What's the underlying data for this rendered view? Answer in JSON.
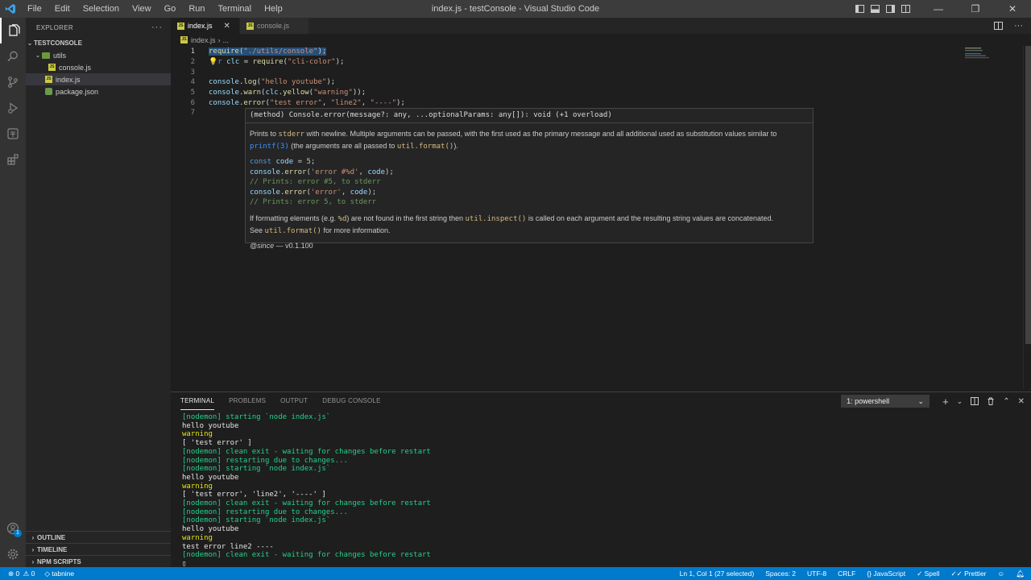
{
  "window": {
    "title": "index.js - testConsole - Visual Studio Code"
  },
  "menu": [
    "File",
    "Edit",
    "Selection",
    "View",
    "Go",
    "Run",
    "Terminal",
    "Help"
  ],
  "sidebar": {
    "header": "EXPLORER",
    "workspace": "TESTCONSOLE",
    "tree": [
      {
        "label": "utils",
        "type": "folder",
        "depth": 1
      },
      {
        "label": "console.js",
        "type": "js",
        "depth": 2
      },
      {
        "label": "index.js",
        "type": "js",
        "depth": 1,
        "active": true
      },
      {
        "label": "package.json",
        "type": "json",
        "depth": 1
      }
    ],
    "sections": [
      "OUTLINE",
      "TIMELINE",
      "NPM SCRIPTS"
    ]
  },
  "tabs": [
    {
      "label": "index.js",
      "active": true
    },
    {
      "label": "console.js",
      "active": false
    }
  ],
  "breadcrumb": {
    "file": "index.js",
    "rest": "..."
  },
  "editor": {
    "line_numbers": [
      "1",
      "2",
      "3",
      "4",
      "5",
      "6",
      "7"
    ],
    "lines": [
      "require(\"./utils/console\");",
      "var clc = require(\"cli-color\");",
      "",
      "console.log(\"hello youtube\");",
      "console.warn(clc.yellow(\"warning\"));",
      "console.error(\"test error\", \"line2\", \"----\");",
      ""
    ],
    "line2_visible": "r clc = require(\"cli-color\");"
  },
  "hover": {
    "signature": "(method) Console.error(message?: any, ...optionalParams: any[]): void (+1 overload)",
    "p1_a": "Prints to ",
    "p1_code1": "stderr",
    "p1_b": " with newline. Multiple arguments can be passed, with the first used as the primary message and all additional used as substitution values similar to",
    "p1_code2": "printf(3)",
    "p1_c": " (the arguments are all passed to ",
    "p1_code3": "util.format()",
    "p1_d": ").",
    "code_lines": [
      "const code = 5;",
      "console.error('error #%d', code);",
      "// Prints: error #5, to stderr",
      "console.error('error', code);",
      "// Prints: error 5, to stderr"
    ],
    "p2_a": "If formatting elements (e.g. ",
    "p2_code1": "%d",
    "p2_b": ") are not found in the first string then ",
    "p2_code2": "util.inspect()",
    "p2_c": " is called on each argument and the resulting string values are concatenated.",
    "p3_a": "See ",
    "p3_code": "util.format()",
    "p3_b": " for more information.",
    "since_tag": "@since",
    "since_value": " — v0.1.100"
  },
  "panel": {
    "tabs": [
      "TERMINAL",
      "PROBLEMS",
      "OUTPUT",
      "DEBUG CONSOLE"
    ],
    "terminal_selector": "1: powershell",
    "terminal_lines": [
      {
        "text": "[nodemon] starting `node index.js`",
        "color": "green"
      },
      {
        "text": "hello youtube",
        "color": "white"
      },
      {
        "text": "warning",
        "color": "yellow"
      },
      {
        "text": "[ 'test error' ]",
        "color": "white"
      },
      {
        "text": "[nodemon] clean exit - waiting for changes before restart",
        "color": "green"
      },
      {
        "text": "[nodemon] restarting due to changes...",
        "color": "green"
      },
      {
        "text": "[nodemon] starting `node index.js`",
        "color": "green"
      },
      {
        "text": "hello youtube",
        "color": "white"
      },
      {
        "text": "warning",
        "color": "yellow"
      },
      {
        "text": "[ 'test error', 'line2', '----' ]",
        "color": "white"
      },
      {
        "text": "[nodemon] clean exit - waiting for changes before restart",
        "color": "green"
      },
      {
        "text": "[nodemon] restarting due to changes...",
        "color": "green"
      },
      {
        "text": "[nodemon] starting `node index.js`",
        "color": "green"
      },
      {
        "text": "hello youtube",
        "color": "white"
      },
      {
        "text": "warning",
        "color": "yellow"
      },
      {
        "text": "test error line2 ----",
        "color": "white"
      },
      {
        "text": "[nodemon] clean exit - waiting for changes before restart",
        "color": "green"
      },
      {
        "text": "▯",
        "color": "white"
      }
    ]
  },
  "statusbar": {
    "errors": "0",
    "warnings": "0",
    "tabnine": "tabnine",
    "position": "Ln 1, Col 1 (27 selected)",
    "spaces": "Spaces: 2",
    "encoding": "UTF-8",
    "eol": "CRLF",
    "language": "JavaScript",
    "spell": "Spell",
    "prettier": "Prettier"
  },
  "colors": {
    "accent": "#007acc",
    "titlebar": "#3c3c3c",
    "sidebar": "#252526",
    "editor": "#1e1e1e"
  }
}
